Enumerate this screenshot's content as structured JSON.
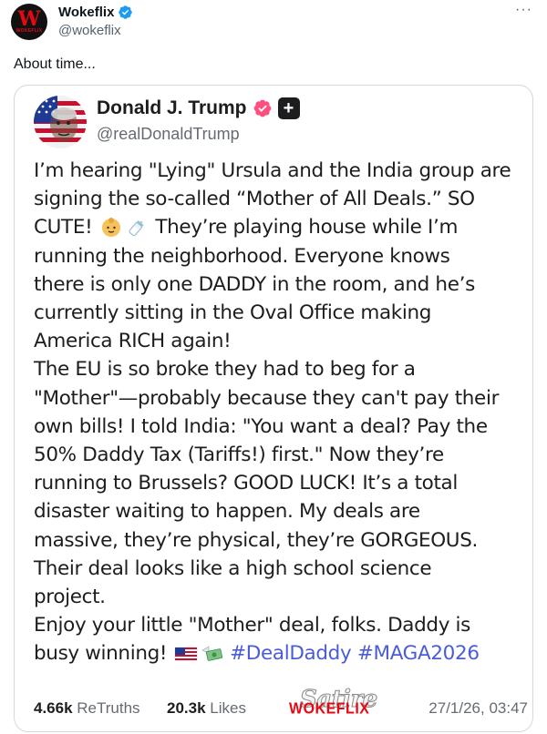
{
  "outer": {
    "account_name": "Wokeflix",
    "handle": "@wokeflix",
    "avatar_letter": "W",
    "avatar_sub": "WOKEFLIX",
    "more": "···",
    "text": "About time..."
  },
  "post": {
    "name": "Donald J. Trump",
    "handle": "@realDonaldTrump",
    "follow_symbol": "+",
    "lines": [
      "I’m hearing \"Lying\" Ursula and the India group are",
      "signing the so-called “Mother of All Deals.” SO",
      "They’re playing house while I’m",
      "running the neighborhood. Everyone knows",
      "there is only one DADDY in the room, and he’s",
      "currently sitting in the Oval Office making",
      "America RICH again!",
      "The EU is so broke they had to beg for a",
      "\"Mother\"—probably because they can't pay their",
      "own bills! I told India: \"You want a deal? Pay the",
      "50% Daddy Tax (Tariffs!) first.\" Now they’re",
      "running to Brussels? GOOD LUCK! It’s a total",
      "disaster waiting to happen. My deals are",
      "massive, they’re physical, they’re GORGEOUS.",
      "Their deal looks like a high school science",
      "project.",
      "Enjoy your little \"Mother\" deal, folks. Daddy is"
    ],
    "cute_word": "CUTE!",
    "last_line_prefix": "busy winning!",
    "hashtags": [
      "#DealDaddy",
      "#MAGA2026"
    ],
    "emojis": [
      "baby-icon",
      "baby-bottle-icon",
      "us-flag-icon",
      "money-with-wings-icon"
    ],
    "retruths_count": "4.66k",
    "retruths_label": "ReTruths",
    "likes_count": "20.3k",
    "likes_label": "Likes",
    "watermark_satire": "Satire",
    "watermark_brand": "WOKEFLIX",
    "date": "27/1/26, 03:47"
  },
  "colors": {
    "verified_blue": "#1d9bf0",
    "truth_verified": "#ff4f7e",
    "hashtag": "#4a5cd8",
    "brand_red": "#e50914"
  }
}
